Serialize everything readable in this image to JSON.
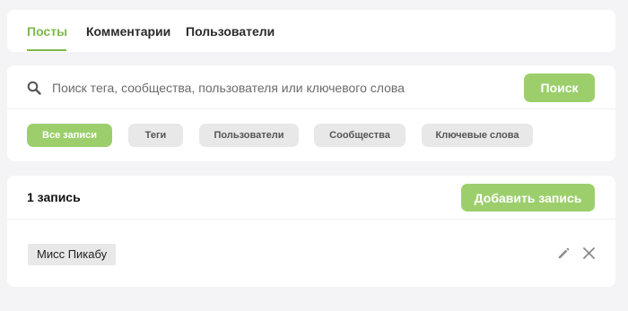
{
  "tabs": [
    {
      "label": "Посты",
      "active": true
    },
    {
      "label": "Комментарии",
      "active": false
    },
    {
      "label": "Пользователи",
      "active": false
    }
  ],
  "search": {
    "placeholder": "Поиск тега, сообщества, пользователя или ключевого слова",
    "value": "",
    "button_label": "Поиск",
    "icon": "search-icon"
  },
  "filters": [
    {
      "label": "Все записи",
      "active": true
    },
    {
      "label": "Теги",
      "active": false
    },
    {
      "label": "Пользователи",
      "active": false
    },
    {
      "label": "Сообщества",
      "active": false
    },
    {
      "label": "Ключевые слова",
      "active": false
    }
  ],
  "posts": {
    "count_label": "1 запись",
    "add_button_label": "Добавить запись",
    "items": [
      {
        "tag": "Мисс Пикабу",
        "edit_icon": "pencil-icon",
        "delete_icon": "close-icon"
      }
    ]
  },
  "colors": {
    "accent": "#9ccf6c",
    "accent_text": "#7fb84a",
    "chip_bg": "#e8e8e8",
    "background": "#f4f4f6"
  }
}
